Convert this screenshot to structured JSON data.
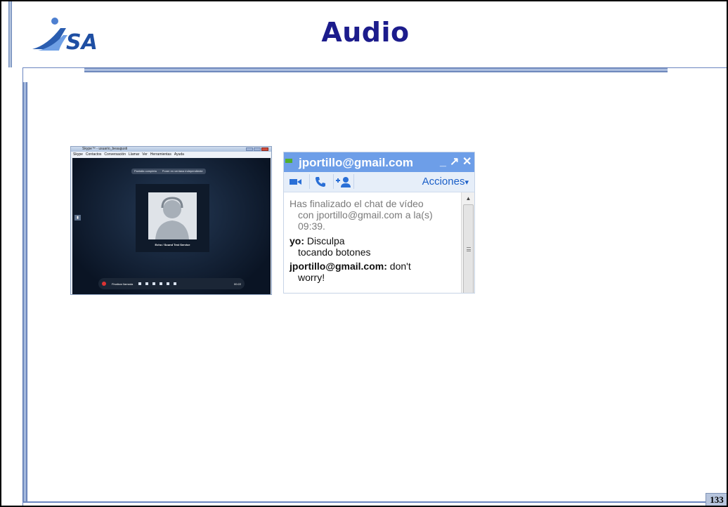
{
  "slide": {
    "title": "Audio",
    "page_number": "133",
    "logo_text": "ISA"
  },
  "skype": {
    "window_title": "Skype™ - usuario_beaugusti",
    "menu": [
      "Skype",
      "Contactos",
      "Conversación",
      "Llamar",
      "Ver",
      "Herramientas",
      "Ayuda"
    ],
    "top_buttons": [
      "Pantalla completa",
      "Poner en ventana independiente"
    ],
    "contact_name": "Echo / Sound Test Service",
    "end_call_label": "Finalizar llamada",
    "call_time": "00:22"
  },
  "chat": {
    "email": "jportillo@gmail.com",
    "header_buttons": {
      "minimize": "_",
      "popout": "↗",
      "close": "✕"
    },
    "actions_label": "Acciones",
    "actions_arrow": "▾",
    "messages": {
      "system_line1": "Has finalizado el chat de vídeo",
      "system_line2": "con jportillo@gmail.com a la(s)",
      "system_line3": "09:39.",
      "me_label": "yo:",
      "me_line1": "Disculpa",
      "me_line2": "tocando botones",
      "other_label": "jportillo@gmail.com:",
      "other_line1": "don't",
      "other_line2": "worry!"
    }
  },
  "colors": {
    "title": "#1c1c8c",
    "chat_header": "#6d9ee8",
    "chat_link": "#1b5fc8",
    "page_box": "#b7c5dd"
  },
  "icons": {
    "chat_status": "video-status-icon",
    "chat_video": "video-camera-icon",
    "chat_phone": "phone-icon",
    "chat_add": "add-user-icon"
  }
}
